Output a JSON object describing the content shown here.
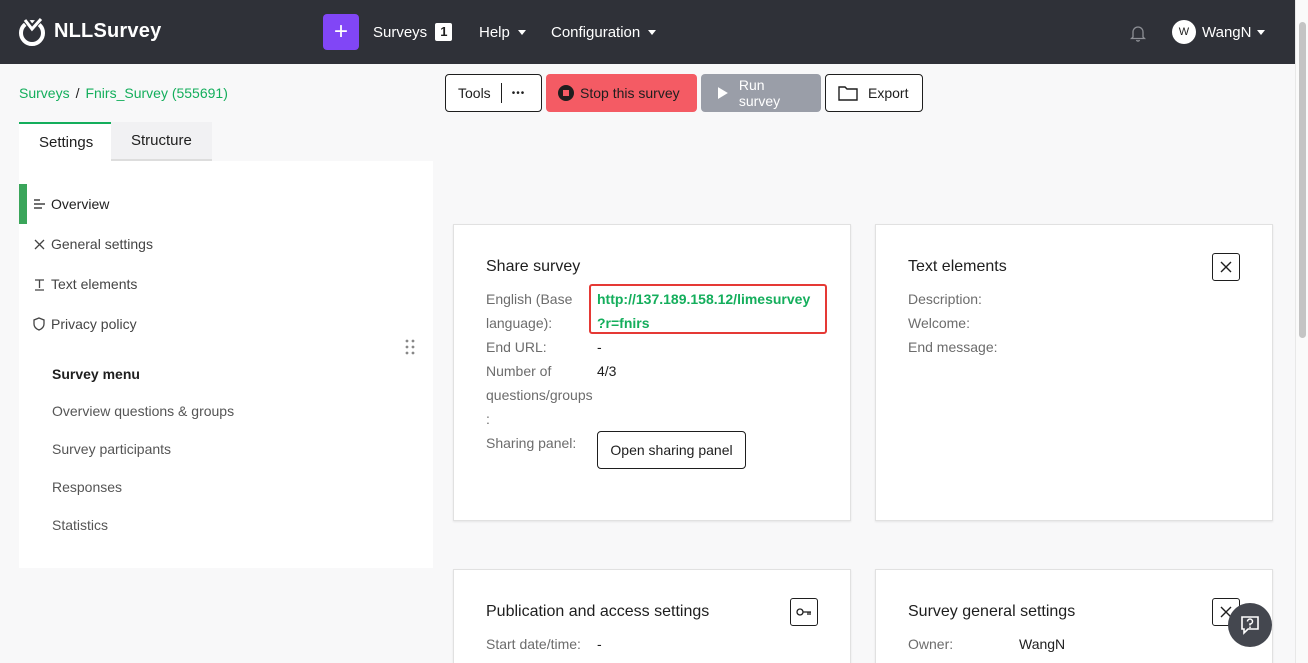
{
  "app": {
    "logo_text": "NLLSurvey",
    "accent_color": "#14ae5c",
    "plus_label": "+"
  },
  "topnav": {
    "surveys_label": "Surveys",
    "surveys_count": "1",
    "help_label": "Help",
    "configuration_label": "Configuration",
    "avatar_initial": "W",
    "user_name": "WangN"
  },
  "breadcrumb": {
    "root": "Surveys",
    "separator": "/",
    "current": "Fnirs_Survey (555691)"
  },
  "toolbar": {
    "tools_label": "Tools",
    "more_label": "•••",
    "stop_label": "Stop this survey",
    "run_label": "Run survey",
    "export_label": "Export"
  },
  "tabs": {
    "settings": "Settings",
    "structure": "Structure"
  },
  "side": {
    "items": [
      {
        "label": "Overview",
        "icon": "list-icon"
      },
      {
        "label": "General settings",
        "icon": "tools-icon"
      },
      {
        "label": "Text elements",
        "icon": "text-icon"
      },
      {
        "label": "Privacy policy",
        "icon": "shield-icon"
      }
    ],
    "menu_title": "Survey menu",
    "menu_items": [
      "Overview questions & groups",
      "Survey participants",
      "Responses",
      "Statistics"
    ]
  },
  "share_card": {
    "title": "Share survey",
    "lang_label_1": "English (Base",
    "lang_label_2": "language):",
    "url_line_1": "http://137.189.158.12/limesurvey",
    "url_line_2": "?r=fnirs",
    "end_url_label": "End URL:",
    "end_url_value": "-",
    "num_label_1": "Number of",
    "num_label_2": "questions/groups",
    "num_label_3": ":",
    "num_value": "4/3",
    "sharing_label": "Sharing panel:",
    "sharing_button": "Open sharing panel"
  },
  "text_card": {
    "title": "Text elements",
    "description_label": "Description:",
    "welcome_label": "Welcome:",
    "end_message_label": "End message:"
  },
  "publication_card": {
    "title": "Publication and access settings",
    "start_label": "Start date/time:",
    "start_value": "-"
  },
  "general_card": {
    "title": "Survey general settings",
    "owner_label": "Owner:",
    "owner_value": "WangN"
  }
}
